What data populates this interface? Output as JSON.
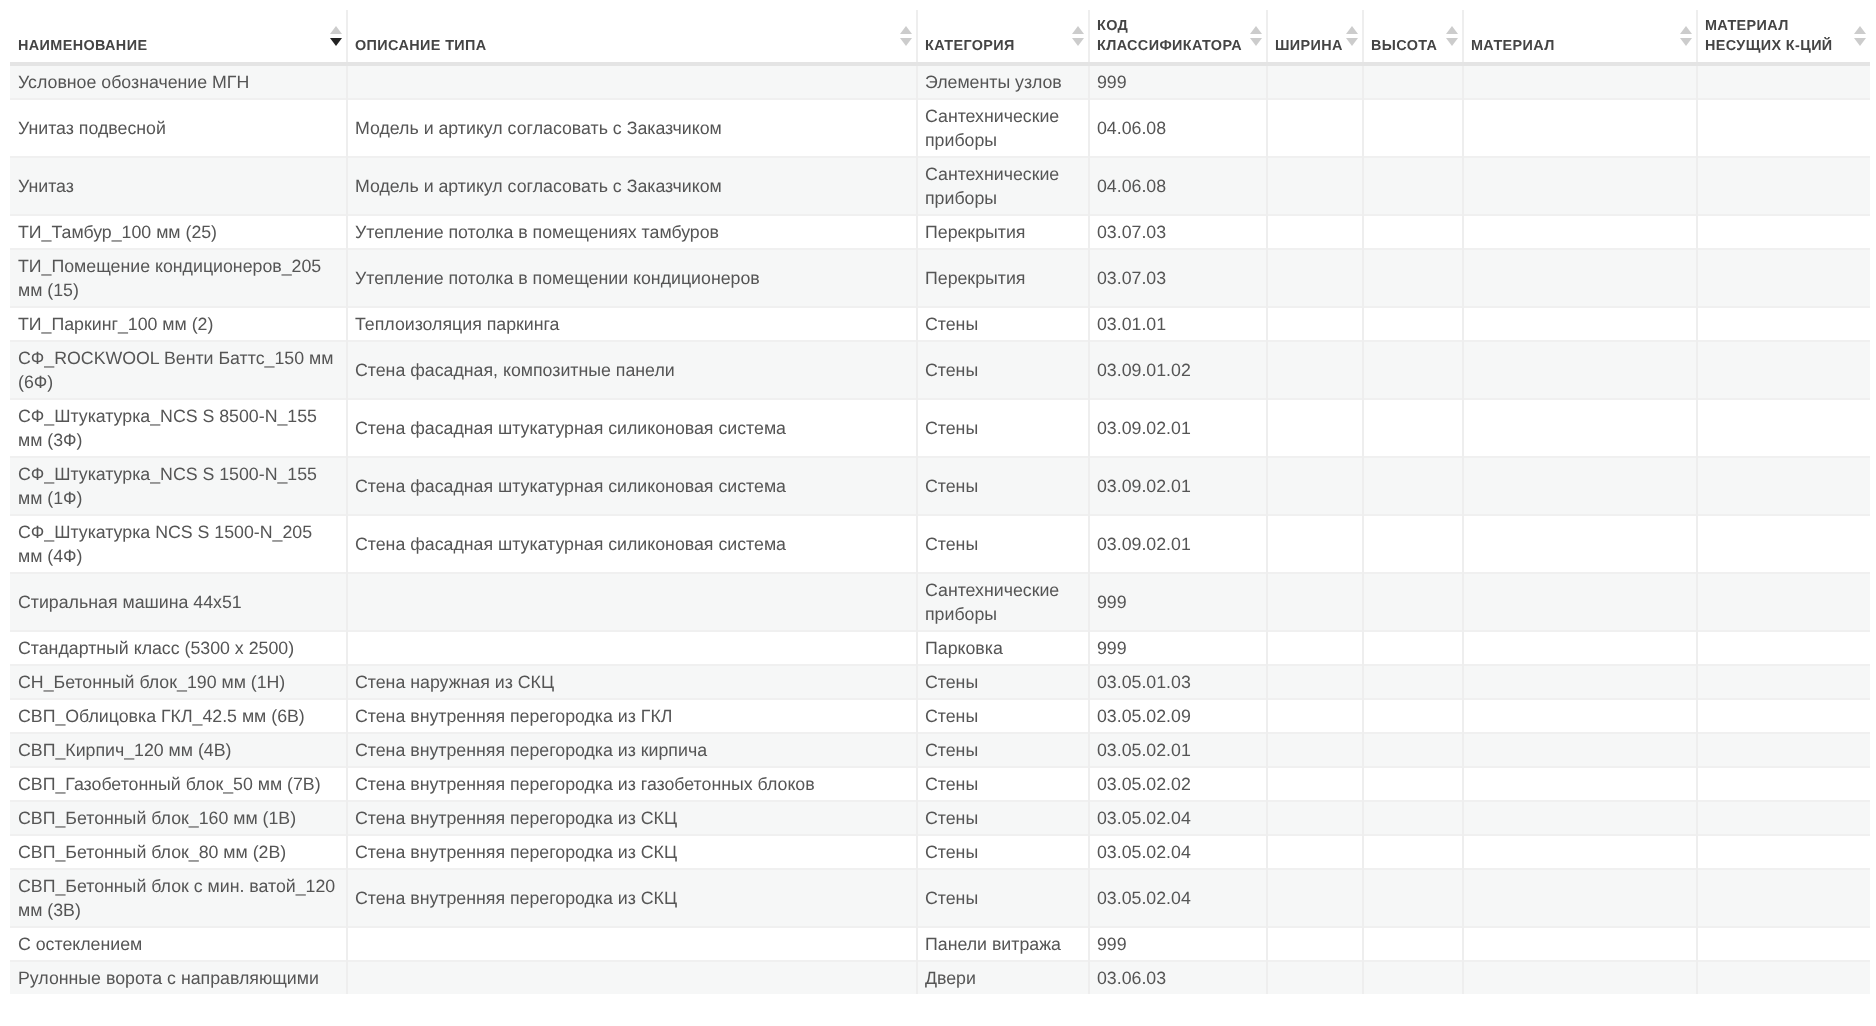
{
  "table": {
    "columns": [
      {
        "label": "НАИМЕНОВАНИЕ",
        "sorted": true
      },
      {
        "label": "ОПИСАНИЕ ТИПА",
        "sorted": false
      },
      {
        "label": "КАТЕГОРИЯ",
        "sorted": false
      },
      {
        "label": "КОД КЛАССИФИКАТОРА",
        "sorted": false
      },
      {
        "label": "ШИРИНА",
        "sorted": false
      },
      {
        "label": "ВЫСОТА",
        "sorted": false
      },
      {
        "label": "МАТЕРИАЛ",
        "sorted": false
      },
      {
        "label": "МАТЕРИАЛ НЕСУЩИХ К-ЦИЙ",
        "sorted": false
      }
    ],
    "rows": [
      {
        "name": "Условное обозначение МГН",
        "category": "Элементы узлов",
        "code": "999"
      },
      {
        "name": "Унитаз подвесной",
        "description": "Модель и артикул согласовать с Заказчиком",
        "category": "Сантехнические приборы",
        "code": "04.06.08"
      },
      {
        "name": "Унитаз",
        "description": "Модель и артикул согласовать с Заказчиком",
        "category": "Сантехнические приборы",
        "code": "04.06.08"
      },
      {
        "name": "ТИ_Тамбур_100 мм (25)",
        "description": "Утепление потолка в помещениях тамбуров",
        "category": "Перекрытия",
        "code": "03.07.03"
      },
      {
        "name": "ТИ_Помещение кондиционеров_205 мм (15)",
        "description": "Утепление потолка в помещении кондиционеров",
        "category": "Перекрытия",
        "code": "03.07.03"
      },
      {
        "name": "ТИ_Паркинг_100 мм (2)",
        "description": "Теплоизоляция паркинга",
        "category": "Стены",
        "code": "03.01.01"
      },
      {
        "name": "СФ_ROCKWOOL Венти Баттс_150 мм (6Ф)",
        "description": "Стена фасадная, композитные панели",
        "category": "Стены",
        "code": "03.09.01.02"
      },
      {
        "name": "СФ_Штукатурка_NCS S 8500-N_155 мм (3Ф)",
        "description": "Стена фасадная штукатурная силиконовая система",
        "category": "Стены",
        "code": "03.09.02.01"
      },
      {
        "name": "СФ_Штукатурка_NCS S 1500-N_155 мм (1Ф)",
        "description": "Стена фасадная штукатурная силиконовая система",
        "category": "Стены",
        "code": "03.09.02.01"
      },
      {
        "name": "СФ_Штукатурка NCS S 1500-N_205 мм (4Ф)",
        "description": "Стена фасадная штукатурная силиконовая система",
        "category": "Стены",
        "code": "03.09.02.01"
      },
      {
        "name": "Стиральная машина 44x51",
        "category": "Сантехнические приборы",
        "code": "999"
      },
      {
        "name": "Стандартный класс (5300 x 2500)",
        "category": "Парковка",
        "code": "999"
      },
      {
        "name": "СН_Бетонный блок_190 мм (1Н)",
        "description": "Стена наружная из СКЦ",
        "category": "Стены",
        "code": "03.05.01.03"
      },
      {
        "name": "СВП_Облицовка ГКЛ_42.5 мм (6В)",
        "description": "Стена внутренняя перегородка из ГКЛ",
        "category": "Стены",
        "code": "03.05.02.09"
      },
      {
        "name": "СВП_Кирпич_120 мм (4В)",
        "description": "Стена внутренняя перегородка из кирпича",
        "category": "Стены",
        "code": "03.05.02.01"
      },
      {
        "name": "СВП_Газобетонный блок_50 мм (7В)",
        "description": "Стена внутренняя перегородка из газобетонных блоков",
        "category": "Стены",
        "code": "03.05.02.02"
      },
      {
        "name": "СВП_Бетонный блок_160 мм (1В)",
        "description": "Стена внутренняя перегородка из СКЦ",
        "category": "Стены",
        "code": "03.05.02.04"
      },
      {
        "name": "СВП_Бетонный блок_80 мм (2В)",
        "description": "Стена внутренняя перегородка из СКЦ",
        "category": "Стены",
        "code": "03.05.02.04"
      },
      {
        "name": "СВП_Бетонный блок с мин. ватой_120 мм (3В)",
        "description": "Стена внутренняя перегородка из СКЦ",
        "category": "Стены",
        "code": "03.05.02.04"
      },
      {
        "name": "С остеклением",
        "category": "Панели витража",
        "code": "999"
      },
      {
        "name": "Рулонные ворота с направляющими",
        "category": "Двери",
        "code": "03.06.03"
      }
    ]
  }
}
